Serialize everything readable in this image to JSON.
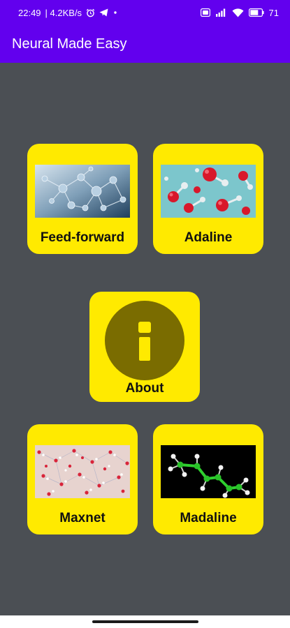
{
  "status_bar": {
    "time": "22:49",
    "network_speed": "| 4.2KB/s",
    "battery_level": "71",
    "icons": [
      "alarm-icon",
      "telegram-icon",
      "dot-icon",
      "sim-card-icon",
      "signal-icon",
      "wifi-icon",
      "battery-icon"
    ]
  },
  "app_bar": {
    "title": "Neural Made Easy"
  },
  "menu": {
    "tiles": [
      {
        "label": "Feed-forward",
        "image": "molecular-network-image"
      },
      {
        "label": "Adaline",
        "image": "red-white-molecules-image"
      },
      {
        "label": "About",
        "icon": "info-icon"
      },
      {
        "label": "Maxnet",
        "image": "molecular-lattice-image"
      },
      {
        "label": "Madaline",
        "image": "green-carbon-chain-image"
      }
    ]
  },
  "colors": {
    "primary": "#6200ee",
    "tile_background": "#ffea00",
    "content_background": "#4b4f54",
    "info_circle": "#7a6c00"
  }
}
